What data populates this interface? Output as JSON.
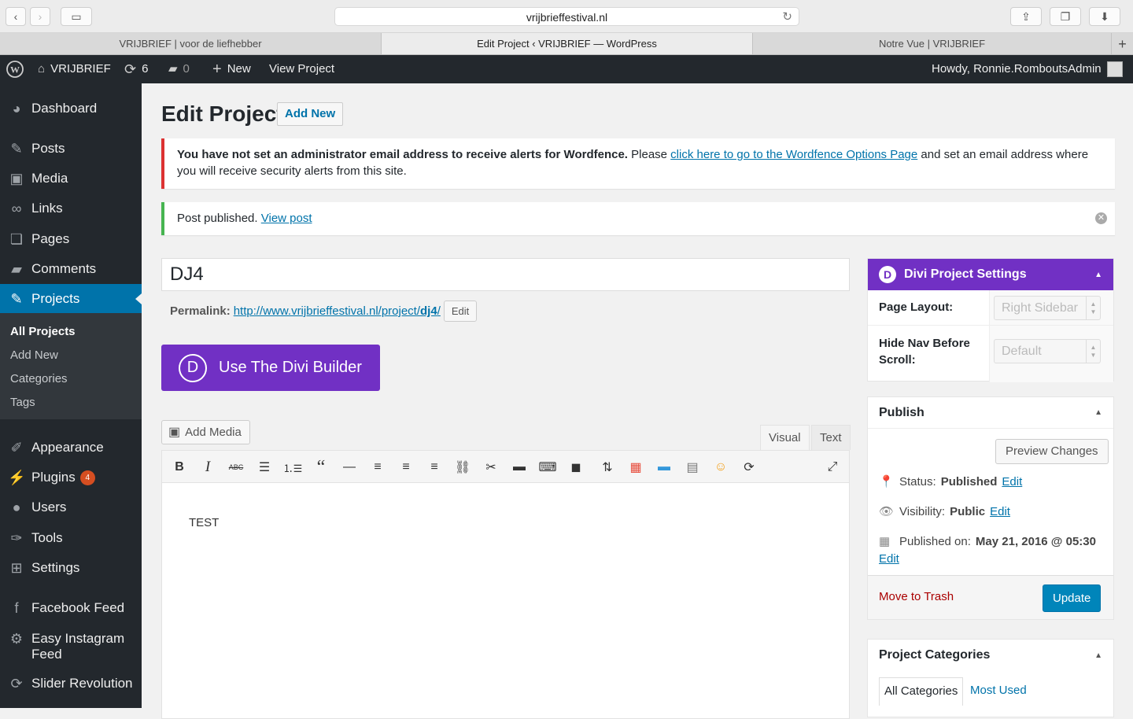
{
  "browser": {
    "url": "vrijbrieffestival.nl",
    "tabs": [
      {
        "label": "VRIJBRIEF | voor de liefhebber"
      },
      {
        "label": "Edit Project ‹ VRIJBRIEF — WordPress"
      },
      {
        "label": "Notre Vue | VRIJBRIEF"
      }
    ]
  },
  "adminbar": {
    "site_name": "VRIJBRIEF",
    "updates_count": "6",
    "comments_count": "0",
    "new_label": "New",
    "view_label": "View Project",
    "howdy": "Howdy, Ronnie.RomboutsAdmin"
  },
  "sidebar": {
    "items": [
      {
        "label": "Dashboard",
        "icon": "dashboard-icon"
      },
      {
        "label": "Posts",
        "icon": "pin-icon"
      },
      {
        "label": "Media",
        "icon": "media-icon"
      },
      {
        "label": "Links",
        "icon": "link-icon"
      },
      {
        "label": "Pages",
        "icon": "pages-icon"
      },
      {
        "label": "Comments",
        "icon": "comment-icon"
      },
      {
        "label": "Projects",
        "icon": "pin-icon"
      },
      {
        "label": "Appearance",
        "icon": "brush-icon"
      },
      {
        "label": "Plugins",
        "icon": "plugin-icon",
        "badge": "4"
      },
      {
        "label": "Users",
        "icon": "user-icon"
      },
      {
        "label": "Tools",
        "icon": "wrench-icon"
      },
      {
        "label": "Settings",
        "icon": "settings-icon"
      },
      {
        "label": "Facebook Feed",
        "icon": "facebook-icon"
      },
      {
        "label": "Easy Instagram Feed",
        "icon": "gear-icon"
      },
      {
        "label": "Slider Revolution",
        "icon": "refresh-icon"
      }
    ],
    "submenu": [
      "All Projects",
      "Add New",
      "Categories",
      "Tags"
    ]
  },
  "page": {
    "title": "Edit Project",
    "add_new": "Add New"
  },
  "notices": {
    "wordfence_bold": "You have not set an administrator email address to receive alerts for Wordfence.",
    "wordfence_pre": " Please ",
    "wordfence_link": "click here to go to the Wordfence Options Page",
    "wordfence_post": " and set an email address where you will receive security alerts from this site.",
    "published_text": "Post published. ",
    "published_link": "View post"
  },
  "post": {
    "title": "DJ4",
    "permalink_label": "Permalink:",
    "permalink_base": "http://www.vrijbrieffestival.nl/project/",
    "permalink_slug": "dj4",
    "permalink_end": "/",
    "permalink_edit": "Edit",
    "content": "TEST"
  },
  "builder": {
    "divi_button": "Use The Divi Builder",
    "d": "D"
  },
  "editor": {
    "add_media": "Add Media",
    "tab_visual": "Visual",
    "tab_text": "Text"
  },
  "divi_settings": {
    "title": "Divi Project Settings",
    "page_layout_label": "Page Layout:",
    "page_layout_value": "Right Sidebar",
    "hide_nav_label": "Hide Nav Before Scroll:",
    "hide_nav_value": "Default"
  },
  "publish": {
    "title": "Publish",
    "preview": "Preview Changes",
    "status_label": "Status:",
    "status_value": "Published",
    "visibility_label": "Visibility:",
    "visibility_value": "Public",
    "published_on_label": "Published on:",
    "published_on_value": "May 21, 2016 @ 05:30",
    "edit": "Edit",
    "trash": "Move to Trash",
    "update": "Update"
  },
  "categories": {
    "title": "Project Categories",
    "tab_all": "All Categories",
    "tab_most": "Most Used"
  },
  "colors": {
    "admin_bg": "#23282d",
    "accent": "#0073aa",
    "divi": "#7130c4",
    "error": "#dc3232",
    "success": "#46b450"
  }
}
